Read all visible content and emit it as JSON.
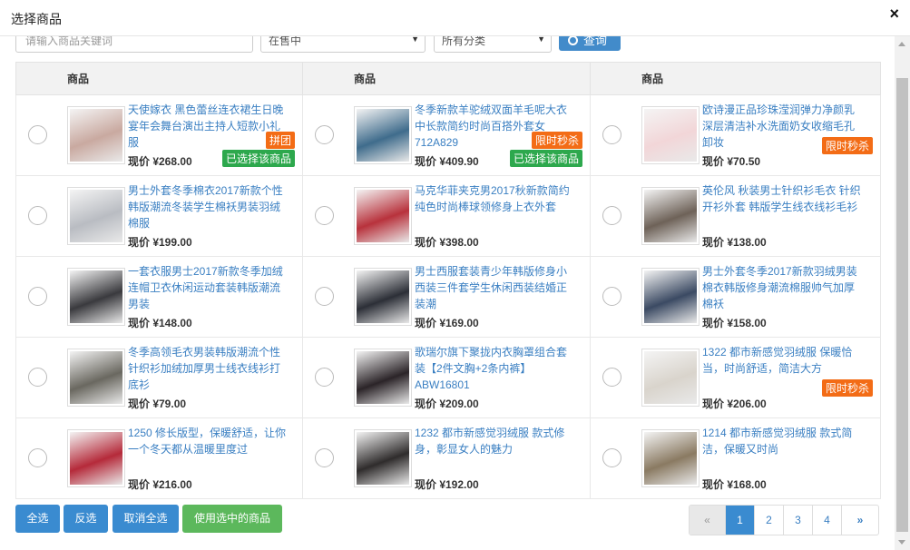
{
  "modal": {
    "title": "选择商品",
    "close_label": "×"
  },
  "filters": {
    "search_placeholder": "请输入商品关键词",
    "status_select": "在售中",
    "category_select": "所有分类",
    "query_button": "查询"
  },
  "table": {
    "headers": [
      "商品",
      "商品",
      "商品"
    ],
    "rows": [
      [
        {
          "title": "天使嫁衣 黑色蕾丝连衣裙生日晚宴年会舞台演出主持人短款小礼服",
          "price": "现价 ¥268.00",
          "tag": "拼团",
          "chosen": "已选择该商品",
          "thumb": "#c9a9a0"
        },
        {
          "title": "冬季新款羊驼绒双面羊毛呢大衣中长款简约时尚百搭外套女712A829",
          "price": "现价 ¥409.90",
          "tag": "限时秒杀",
          "chosen": "已选择该商品",
          "thumb": "#3f6c8c"
        },
        {
          "title": "欧诗漫正品珍珠滢润弹力净颜乳深层清洁补水洗面奶女收缩毛孔卸妆",
          "price": "现价 ¥70.50",
          "tag": "限时秒杀",
          "chosen": "",
          "thumb": "#f2d6d8"
        }
      ],
      [
        {
          "title": "男士外套冬季棉衣2017新款个性韩版潮流冬装学生棉袄男装羽绒棉服",
          "price": "现价 ¥199.00",
          "tag": "",
          "chosen": "",
          "thumb": "#b9bcc2"
        },
        {
          "title": "马克华菲夹克男2017秋新款简约纯色时尚棒球领修身上衣外套",
          "price": "现价 ¥398.00",
          "tag": "",
          "chosen": "",
          "thumb": "#b8323c"
        },
        {
          "title": "英伦风 秋装男士针织衫毛衣 针织开衫外套 韩版学生线衣线衫毛衫",
          "price": "现价 ¥138.00",
          "tag": "",
          "chosen": "",
          "thumb": "#6e6258"
        }
      ],
      [
        {
          "title": "一套衣服男士2017新款冬季加绒连帽卫衣休闲运动套装韩版潮流男装",
          "price": "现价 ¥148.00",
          "tag": "",
          "chosen": "",
          "thumb": "#3a3a3e"
        },
        {
          "title": "男士西服套装青少年韩版修身小西装三件套学生休闲西装结婚正装潮",
          "price": "现价 ¥169.00",
          "tag": "",
          "chosen": "",
          "thumb": "#2c2f37"
        },
        {
          "title": "男士外套冬季2017新款羽绒男装棉衣韩版修身潮流棉服帅气加厚棉袄",
          "price": "现价 ¥158.00",
          "tag": "",
          "chosen": "",
          "thumb": "#3b4a63"
        }
      ],
      [
        {
          "title": "冬季高领毛衣男装韩版潮流个性针织衫加绒加厚男士线衣线衫打底衫",
          "price": "现价 ¥79.00",
          "tag": "",
          "chosen": "",
          "thumb": "#6a6860"
        },
        {
          "title": "歌瑞尔旗下聚拢内衣胸罩组合套装【2件文胸+2条内裤】ABW16801",
          "price": "现价 ¥209.00",
          "tag": "",
          "chosen": "",
          "thumb": "#2b2428"
        },
        {
          "title": "1322 都市新感觉羽绒服 保暖恰当，时尚舒适，简洁大方",
          "price": "现价 ¥206.00",
          "tag": "限时秒杀",
          "chosen": "",
          "thumb": "#d9d4cc"
        }
      ],
      [
        {
          "title": "1250 修长版型，保暖舒适，让你一个冬天都从温暖里度过",
          "price": "现价 ¥216.00",
          "tag": "",
          "chosen": "",
          "thumb": "#b52a3a"
        },
        {
          "title": "1232 都市新感觉羽绒服 款式修身，彰显女人的魅力",
          "price": "现价 ¥192.00",
          "tag": "",
          "chosen": "",
          "thumb": "#2f2c2c"
        },
        {
          "title": "1214 都市新感觉羽绒服 款式简洁，保暖又时尚",
          "price": "现价 ¥168.00",
          "tag": "",
          "chosen": "",
          "thumb": "#8a7a62"
        }
      ]
    ]
  },
  "actions": {
    "select_all": "全选",
    "invert": "反选",
    "clear_all": "取消全选",
    "use_selected": "使用选中的商品"
  },
  "pager": {
    "prev": "«",
    "pages": [
      "1",
      "2",
      "3",
      "4"
    ],
    "active": "1",
    "next": "»"
  }
}
